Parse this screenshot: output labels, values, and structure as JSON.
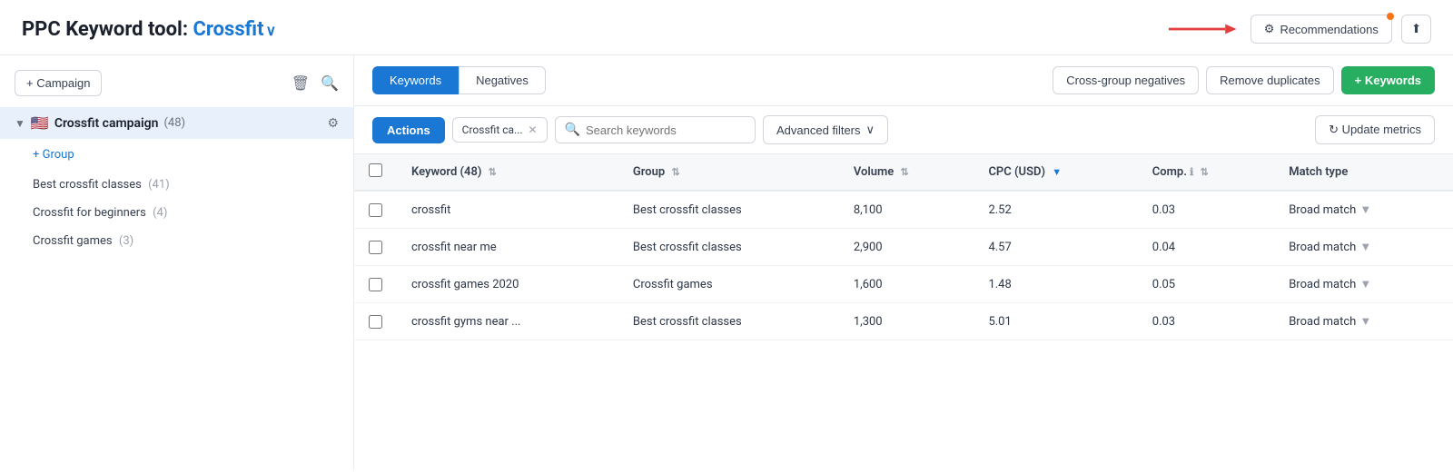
{
  "header": {
    "title_prefix": "PPC Keyword tool: ",
    "title_highlight": "Crossfit",
    "chevron": "∨",
    "recommendations_label": "Recommendations",
    "export_label": "⬆"
  },
  "sidebar": {
    "add_campaign_label": "+ Campaign",
    "campaign": {
      "name": "Crossfit campaign",
      "count": "(48)",
      "flag": "🇺🇸"
    },
    "add_group_label": "+ Group",
    "groups": [
      {
        "name": "Best crossfit classes",
        "count": "(41)"
      },
      {
        "name": "Crossfit for beginners",
        "count": "(4)"
      },
      {
        "name": "Crossfit games",
        "count": "(3)"
      }
    ]
  },
  "tabs": {
    "keywords_label": "Keywords",
    "negatives_label": "Negatives"
  },
  "action_buttons": {
    "cross_group_negatives": "Cross-group negatives",
    "remove_duplicates": "Remove duplicates",
    "add_keywords": "+ Keywords"
  },
  "filter_bar": {
    "actions_label": "Actions",
    "campaign_chip_label": "Crossfit ca...",
    "search_placeholder": "Search keywords",
    "advanced_filters_label": "Advanced filters",
    "chevron": "∨",
    "update_metrics_label": "↻  Update metrics"
  },
  "table": {
    "columns": [
      {
        "id": "checkbox",
        "label": ""
      },
      {
        "id": "keyword",
        "label": "Keyword (48)",
        "sortable": true
      },
      {
        "id": "group",
        "label": "Group",
        "sortable": true
      },
      {
        "id": "volume",
        "label": "Volume",
        "sortable": true
      },
      {
        "id": "cpc",
        "label": "CPC (USD)",
        "sortable": true,
        "sort_active": true,
        "sort_dir": "desc"
      },
      {
        "id": "comp",
        "label": "Comp.",
        "sortable": true,
        "info": true
      },
      {
        "id": "match_type",
        "label": "Match type"
      }
    ],
    "rows": [
      {
        "keyword": "crossfit",
        "group": "Best crossfit classes",
        "volume": "8,100",
        "cpc": "2.52",
        "comp": "0.03",
        "match_type": "Broad match"
      },
      {
        "keyword": "crossfit near me",
        "group": "Best crossfit classes",
        "volume": "2,900",
        "cpc": "4.57",
        "comp": "0.04",
        "match_type": "Broad match"
      },
      {
        "keyword": "crossfit games 2020",
        "group": "Crossfit games",
        "volume": "1,600",
        "cpc": "1.48",
        "comp": "0.05",
        "match_type": "Broad match"
      },
      {
        "keyword": "crossfit gyms near ...",
        "group": "Best crossfit classes",
        "volume": "1,300",
        "cpc": "5.01",
        "comp": "0.03",
        "match_type": "Broad match"
      }
    ]
  }
}
